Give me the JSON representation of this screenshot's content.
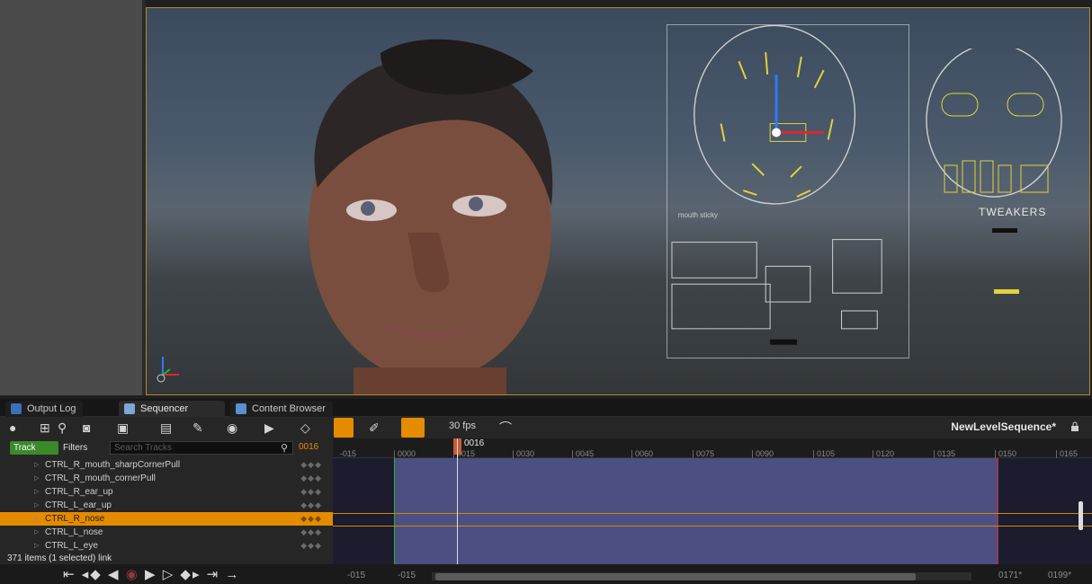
{
  "tabs": [
    {
      "label": "Output Log",
      "active": false
    },
    {
      "label": "Sequencer",
      "active": true
    },
    {
      "label": "Content Browser",
      "active": false
    }
  ],
  "toolbar": {
    "fps": "30 fps",
    "sequence_name": "NewLevelSequence*"
  },
  "filter_row": {
    "track_button": "Track",
    "filters_button": "Filters",
    "search_placeholder": "Search Tracks",
    "current_frame": "0016"
  },
  "ruler": {
    "playhead_label": "0016",
    "ticks": [
      "-015",
      "0000",
      "0015",
      "0030",
      "0045",
      "0060",
      "0075",
      "0090",
      "0105",
      "0120",
      "0135",
      "0150",
      "0165"
    ]
  },
  "tracks": [
    {
      "name": "CTRL_R_mouth_sharpCornerPull",
      "selected": false
    },
    {
      "name": "CTRL_R_mouth_cornerPull",
      "selected": false
    },
    {
      "name": "CTRL_R_ear_up",
      "selected": false
    },
    {
      "name": "CTRL_L_ear_up",
      "selected": false
    },
    {
      "name": "CTRL_R_nose",
      "selected": true
    },
    {
      "name": "CTRL_L_nose",
      "selected": false
    },
    {
      "name": "CTRL_L_eye",
      "selected": false
    }
  ],
  "status": {
    "items": "371 items (1 selected)",
    "link": "link"
  },
  "bottom": {
    "range_start": "-015",
    "view_start": "-015",
    "view_end": "0171*",
    "range_end": "0199*"
  },
  "viewport_overlays": {
    "tweakers_label": "TWEAKERS",
    "mouth_sticky": "mouth sticky"
  },
  "colors": {
    "accent": "#e58b00",
    "track_green": "#3a8a2a",
    "range_bg": "#4c4f82"
  }
}
